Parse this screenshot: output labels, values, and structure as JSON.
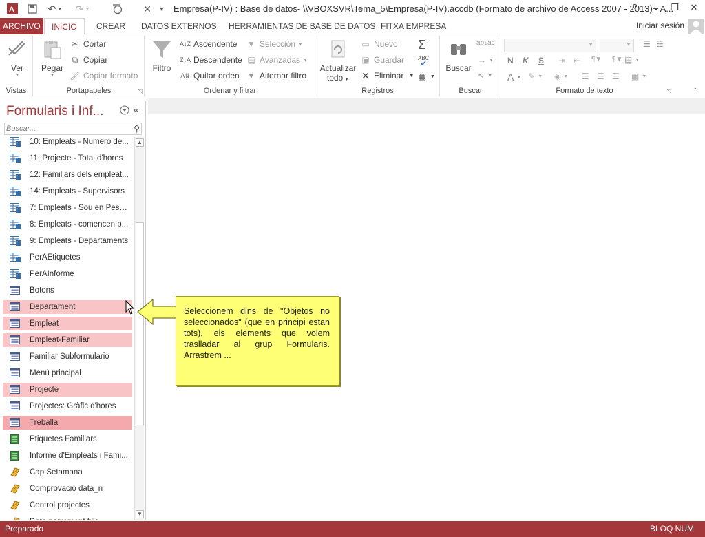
{
  "titlebar": {
    "title": "Empresa(P-IV) : Base de datos- \\\\VBOXSVR\\Tema_5\\Empresa(P-IV).accdb (Formato de archivo de Access 2007 - 2013) - A...",
    "help": "?"
  },
  "tabs": {
    "file": "ARCHIVO",
    "items": [
      "INICIO",
      "CREAR",
      "DATOS EXTERNOS",
      "HERRAMIENTAS DE BASE DE DATOS",
      "FITXA EMPRESA"
    ],
    "login": "Iniciar sesión"
  },
  "ribbon": {
    "vistas": {
      "label": "Vistas",
      "ver": "Ver"
    },
    "portapapeles": {
      "label": "Portapapeles",
      "pegar": "Pegar",
      "cortar": "Cortar",
      "copiar": "Copiar",
      "copiar_formato": "Copiar formato"
    },
    "ordenar": {
      "label": "Ordenar y filtrar",
      "filtro": "Filtro",
      "ascendente": "Ascendente",
      "descendente": "Descendente",
      "quitar_orden": "Quitar orden",
      "seleccion": "Selección",
      "avanzadas": "Avanzadas",
      "alternar": "Alternar filtro"
    },
    "registros": {
      "label": "Registros",
      "actualizar": "Actualizar",
      "todo": "todo",
      "nuevo": "Nuevo",
      "guardar": "Guardar",
      "eliminar": "Eliminar"
    },
    "buscar": {
      "label": "Buscar",
      "buscar": "Buscar"
    },
    "formato": {
      "label": "Formato de texto",
      "n": "N",
      "k": "K",
      "s": "S",
      "a": "A"
    }
  },
  "nav": {
    "title": "Formularis i Inf...",
    "search_placeholder": "Buscar...",
    "items": [
      {
        "label": "10: Empleats - Numero de...",
        "icon": "query",
        "state": "none"
      },
      {
        "label": "11: Projecte - Total d'hores",
        "icon": "query",
        "state": "none"
      },
      {
        "label": "12: Familiars dels empleat...",
        "icon": "query",
        "state": "none"
      },
      {
        "label": "14: Empleats - Supervisors",
        "icon": "query",
        "state": "none"
      },
      {
        "label": "7: Empleats - Sou en Pess...",
        "icon": "query",
        "state": "none"
      },
      {
        "label": "8: Empleats - comencen p...",
        "icon": "query",
        "state": "none"
      },
      {
        "label": "9: Empleats - Departaments",
        "icon": "query",
        "state": "none"
      },
      {
        "label": "PerAEtiquetes",
        "icon": "query",
        "state": "none"
      },
      {
        "label": "PerAInforme",
        "icon": "query",
        "state": "none"
      },
      {
        "label": "Botons",
        "icon": "form",
        "state": "none"
      },
      {
        "label": "Departament",
        "icon": "form",
        "state": "selected"
      },
      {
        "label": "Empleat",
        "icon": "form",
        "state": "selected"
      },
      {
        "label": "Empleat-Familiar",
        "icon": "form",
        "state": "selected"
      },
      {
        "label": "Familiar Subformulario",
        "icon": "form",
        "state": "none"
      },
      {
        "label": "Menú principal",
        "icon": "form",
        "state": "none"
      },
      {
        "label": "Projecte",
        "icon": "form",
        "state": "selected"
      },
      {
        "label": "Projectes: Gràfic d'hores",
        "icon": "form",
        "state": "none"
      },
      {
        "label": "Treballa",
        "icon": "form",
        "state": "focused"
      },
      {
        "label": "Etiquetes Familiars",
        "icon": "report",
        "state": "none"
      },
      {
        "label": "Informe d'Empleats i Fami...",
        "icon": "report",
        "state": "none"
      },
      {
        "label": "Cap Setamana",
        "icon": "macro",
        "state": "none"
      },
      {
        "label": "Comprovació data_n",
        "icon": "macro",
        "state": "none"
      },
      {
        "label": "Control projectes",
        "icon": "macro",
        "state": "none"
      },
      {
        "label": "Data paixement fills",
        "icon": "macro",
        "state": "none"
      }
    ]
  },
  "callout": {
    "text": "Seleccionem dins de \"Objetos no seleccionados\" (que en principi estan tots), els elements que volem traslladar al grup Formularis. Arrastrem ..."
  },
  "status": {
    "left": "Preparado",
    "right": "BLOQ NUM"
  },
  "colors": {
    "accent": "#a4373a",
    "selected": "#f9c4c6",
    "focused": "#f4a9ac",
    "callout": "#ffff75"
  }
}
